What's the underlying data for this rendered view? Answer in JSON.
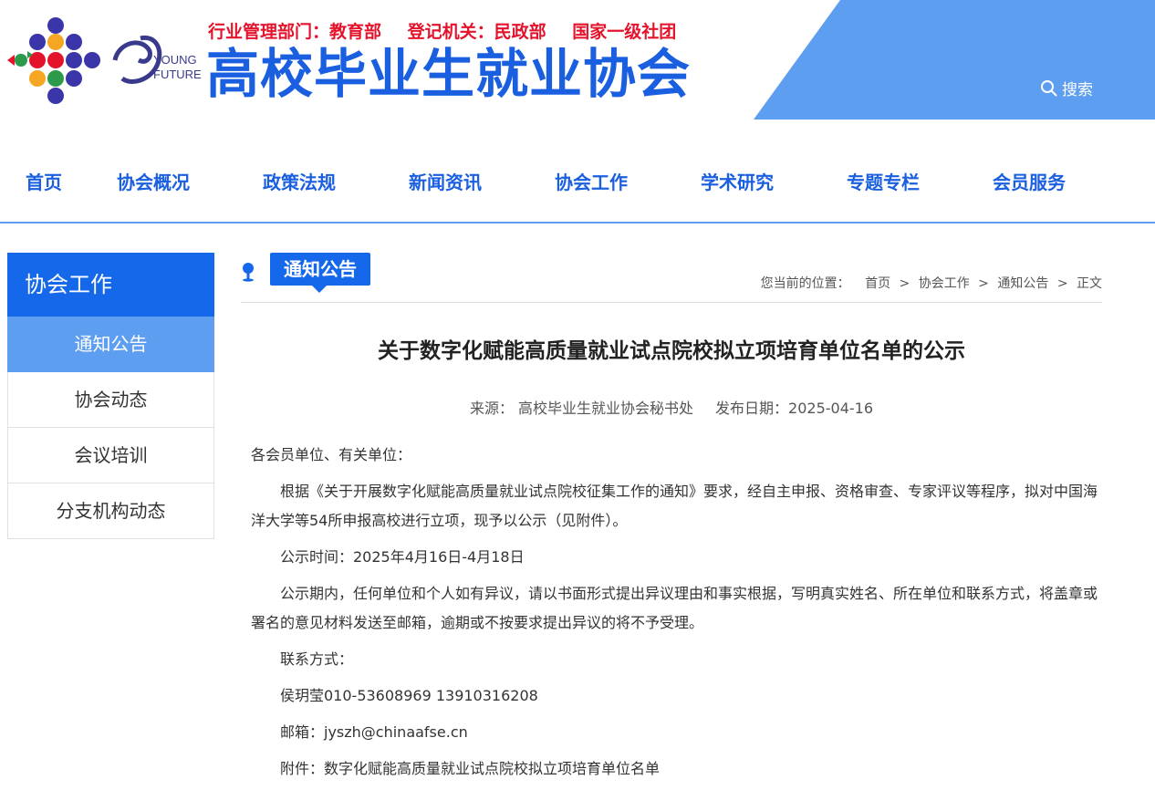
{
  "header": {
    "registration": [
      "行业管理部门：教育部",
      "登记机关：民政部",
      "国家一级社团"
    ],
    "org_name": "高校毕业生就业协会",
    "logo_text_1": "YOUNG",
    "logo_text_2": "FUTURE",
    "search_label": "搜索",
    "colors": {
      "brand_blue": "#1a5fe0",
      "accent_blue": "#5e9ef0",
      "registration_red": "#e3132c"
    }
  },
  "nav": {
    "items": [
      "首页",
      "协会概况",
      "政策法规",
      "新闻资讯",
      "协会工作",
      "学术研究",
      "专题专栏",
      "会员服务"
    ]
  },
  "sidebar": {
    "title": "协会工作",
    "items": [
      {
        "label": "通知公告",
        "active": true
      },
      {
        "label": "协会动态",
        "active": false
      },
      {
        "label": "会议培训",
        "active": false
      },
      {
        "label": "分支机构动态",
        "active": false
      }
    ]
  },
  "main": {
    "section_tag": "通知公告",
    "breadcrumb": {
      "label": "您当前的位置：",
      "items": [
        "首页",
        "协会工作",
        "通知公告",
        "正文"
      ]
    },
    "article": {
      "title": "关于数字化赋能高质量就业试点院校拟立项培育单位名单的公示",
      "source": "来源：  高校毕业生就业协会秘书处",
      "date": "发布日期：2025-04-16",
      "paragraphs": [
        "各会员单位、有关单位：",
        "根据《关于开展数字化赋能高质量就业试点院校征集工作的通知》要求，经自主申报、资格审查、专家评议等程序，拟对中国海洋大学等54所申报高校进行立项，现予以公示（见附件）。",
        "公示时间：2025年4月16日-4月18日",
        "公示期内，任何单位和个人如有异议，请以书面形式提出异议理由和事实根据，写明真实姓名、所在单位和联系方式，将盖章或署名的意见材料发送至邮箱，逾期或不按要求提出异议的将不予受理。",
        "联系方式：",
        "侯玥莹010-53608969 13910316208",
        "邮箱：jyszh@chinaafse.cn",
        "附件：数字化赋能高质量就业试点院校拟立项培育单位名单"
      ]
    }
  }
}
